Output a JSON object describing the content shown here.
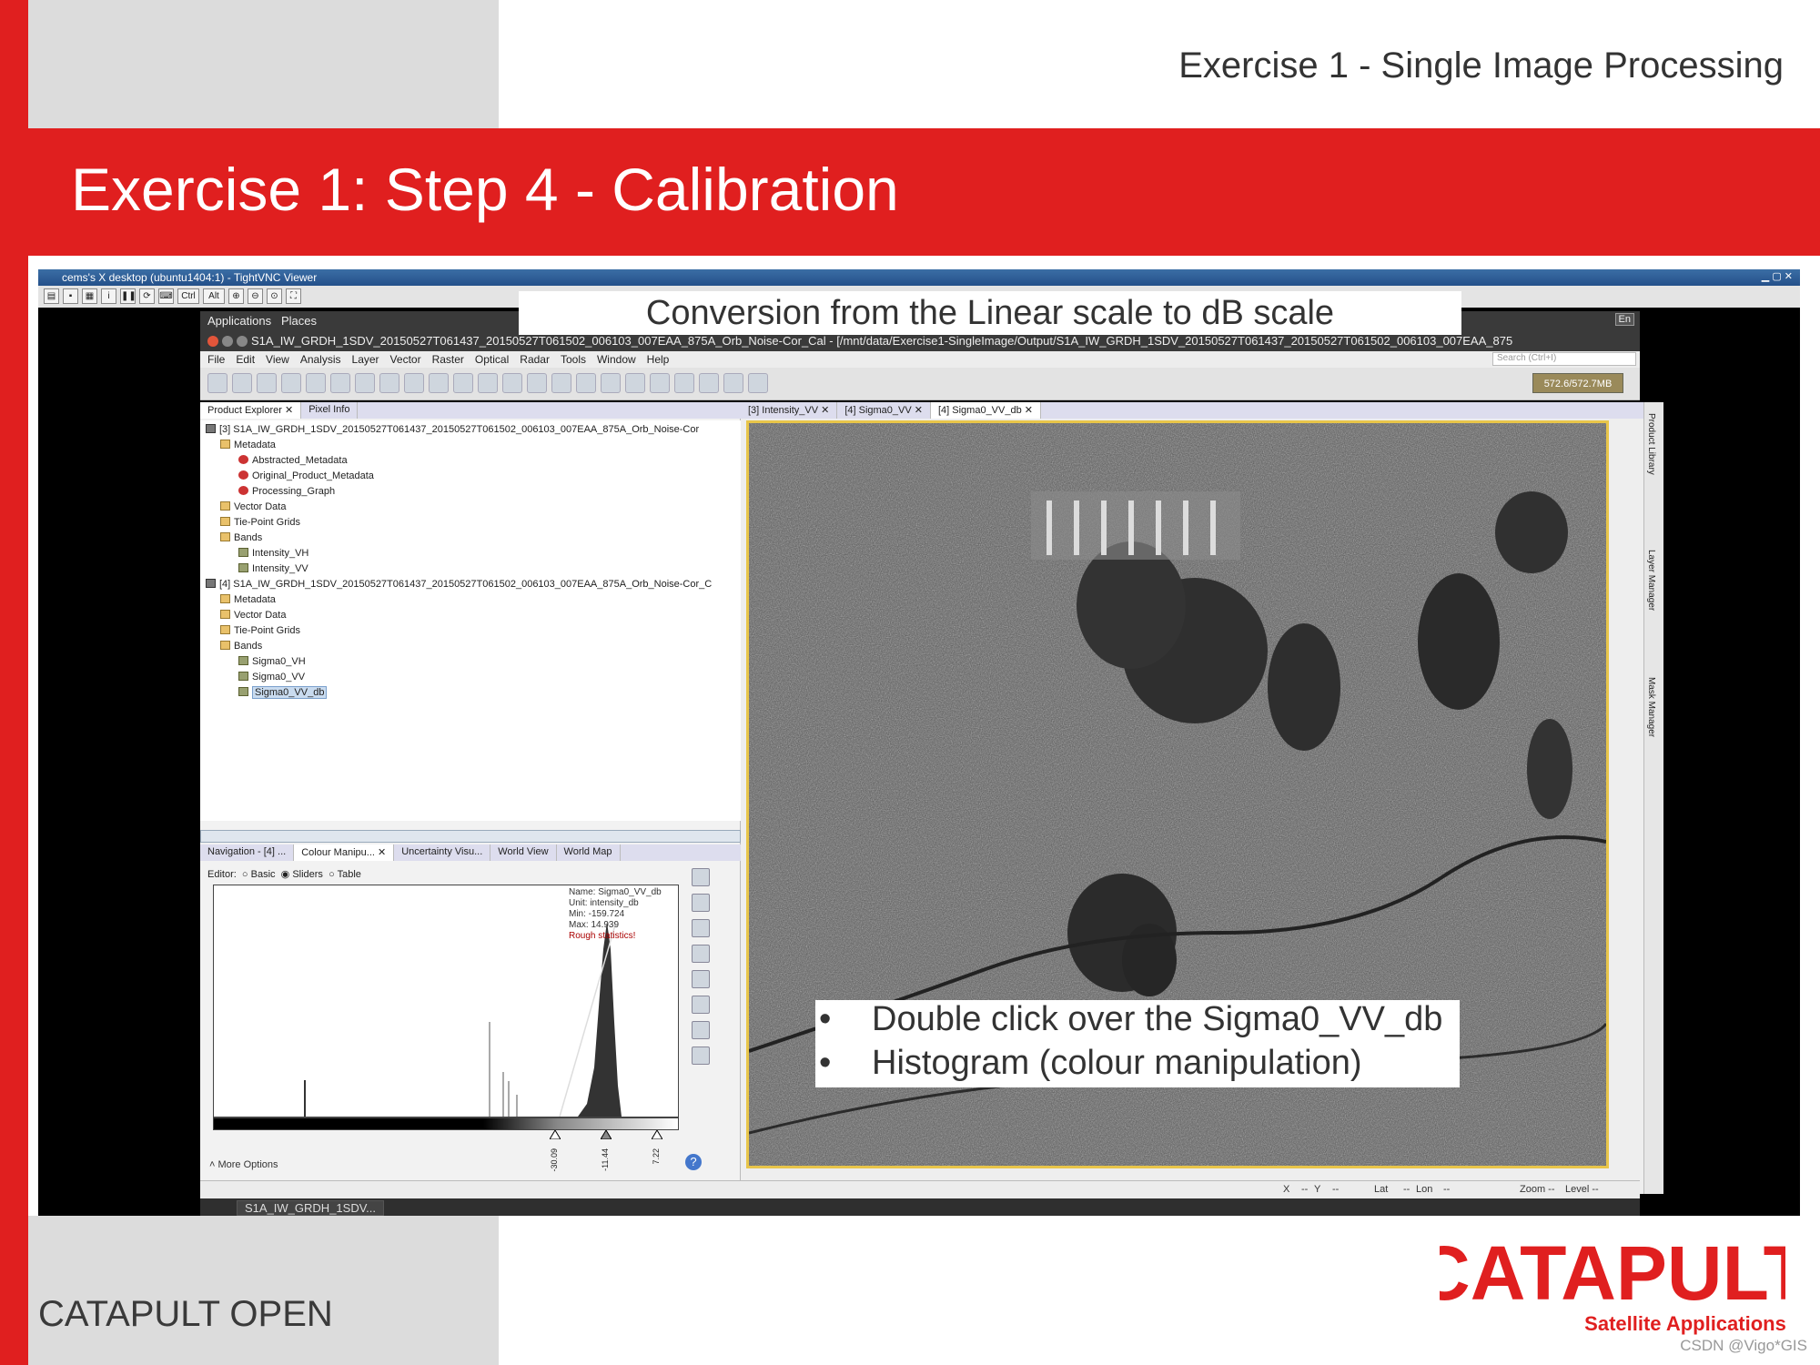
{
  "slide": {
    "header_text": "Exercise 1 - Single Image Processing",
    "title": "Exercise 1: Step 4 - Calibration",
    "footer_left": "CATAPULT OPEN",
    "logo_main": "CATAPULT",
    "logo_sub": "Satellite Applications",
    "credit": "CSDN @Vigo*GIS",
    "overlay_conversion": "Conversion from the Linear scale to dB scale",
    "bullets": [
      "Double click over the Sigma0_VV_db",
      "Histogram (colour manipulation)"
    ],
    "bullet_glyph": "•"
  },
  "vnc": {
    "window_title": "cems's X desktop (ubuntu1404:1) - TightVNC Viewer",
    "toolbar_keys": [
      "Ctrl",
      "Alt"
    ]
  },
  "gnome": {
    "applications": "Applications",
    "places": "Places",
    "lang": "En"
  },
  "snap": {
    "window_title": "S1A_IW_GRDH_1SDV_20150527T061437_20150527T061502_006103_007EAA_875A_Orb_Noise-Cor_Cal - [/mnt/data/Exercise1-SingleImage/Output/S1A_IW_GRDH_1SDV_20150527T061437_20150527T061502_006103_007EAA_875",
    "menu": [
      "File",
      "Edit",
      "View",
      "Analysis",
      "Layer",
      "Vector",
      "Raster",
      "Optical",
      "Radar",
      "Tools",
      "Window",
      "Help"
    ],
    "search_placeholder": "Search (Ctrl+I)",
    "memory": "572.6/572.7MB",
    "panel_tabs": [
      "Product Explorer",
      "Pixel Info"
    ],
    "tree": [
      {
        "label": "[3] S1A_IW_GRDH_1SDV_20150527T061437_20150527T061502_006103_007EAA_875A_Orb_Noise-Cor",
        "icon": "product"
      },
      {
        "label": "Metadata",
        "icon": "folder"
      },
      {
        "label": "Abstracted_Metadata",
        "icon": "meta"
      },
      {
        "label": "Original_Product_Metadata",
        "icon": "meta"
      },
      {
        "label": "Processing_Graph",
        "icon": "meta"
      },
      {
        "label": "Vector Data",
        "icon": "folder"
      },
      {
        "label": "Tie-Point Grids",
        "icon": "folder"
      },
      {
        "label": "Bands",
        "icon": "folder"
      },
      {
        "label": "Intensity_VH",
        "icon": "band"
      },
      {
        "label": "Intensity_VV",
        "icon": "band"
      },
      {
        "label": "[4] S1A_IW_GRDH_1SDV_20150527T061437_20150527T061502_006103_007EAA_875A_Orb_Noise-Cor_C",
        "icon": "product"
      },
      {
        "label": "Metadata",
        "icon": "folder"
      },
      {
        "label": "Vector Data",
        "icon": "folder"
      },
      {
        "label": "Tie-Point Grids",
        "icon": "folder"
      },
      {
        "label": "Bands",
        "icon": "folder"
      },
      {
        "label": "Sigma0_VH",
        "icon": "band"
      },
      {
        "label": "Sigma0_VV",
        "icon": "band"
      },
      {
        "label": "Sigma0_VV_db",
        "icon": "band"
      }
    ],
    "bottom_tabs": [
      "Navigation - [4] ...",
      "Colour Manipu...",
      "Uncertainty Visu...",
      "World View",
      "World Map"
    ],
    "editor_label": "Editor:",
    "editor_options": [
      "Basic",
      "Sliders",
      "Table"
    ],
    "editor_selected": "Sliders",
    "histogram": {
      "name": "Name: Sigma0_VV_db",
      "unit": "Unit: intensity_db",
      "min": "Min: -159.724",
      "max": "Max: 14.939",
      "rough": "Rough statistics!"
    },
    "slider_labels": [
      "-30.09",
      "-11.44",
      "7.22"
    ],
    "more_options": "More Options",
    "image_tabs": [
      "[3] Intensity_VV",
      "[4] Sigma0_VV",
      "[4] Sigma0_VV_db"
    ],
    "right_rail": [
      "Product Library",
      "Layer Manager",
      "Mask Manager"
    ],
    "status": {
      "x": "X",
      "x_val": "--",
      "y": "Y",
      "y_val": "--",
      "lat": "Lat",
      "lat_val": "--",
      "lon": "Lon",
      "lon_val": "--",
      "zoom": "Zoom --",
      "level": "Level --"
    },
    "taskbar_item": "S1A_IW_GRDH_1SDV..."
  }
}
